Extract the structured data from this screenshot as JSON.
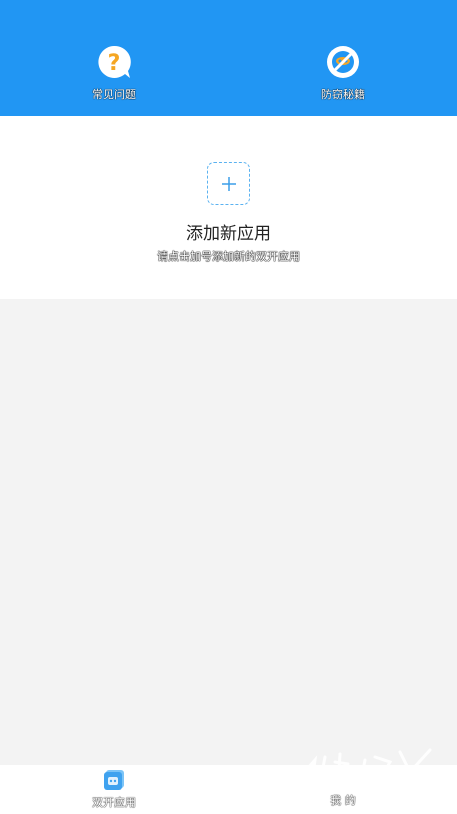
{
  "header": {
    "faq_label": "常见问题",
    "anti_label": "防窃秘籍"
  },
  "add_app": {
    "title": "添加新应用",
    "subtitle": "请点击加号添加新的双开应用"
  },
  "tabbar": {
    "apps_label": "双开应用",
    "me_label": "我 的"
  },
  "colors": {
    "header_bg": "#2196f3",
    "accent": "#5bb2f0",
    "icon_orange": "#f5a623"
  }
}
